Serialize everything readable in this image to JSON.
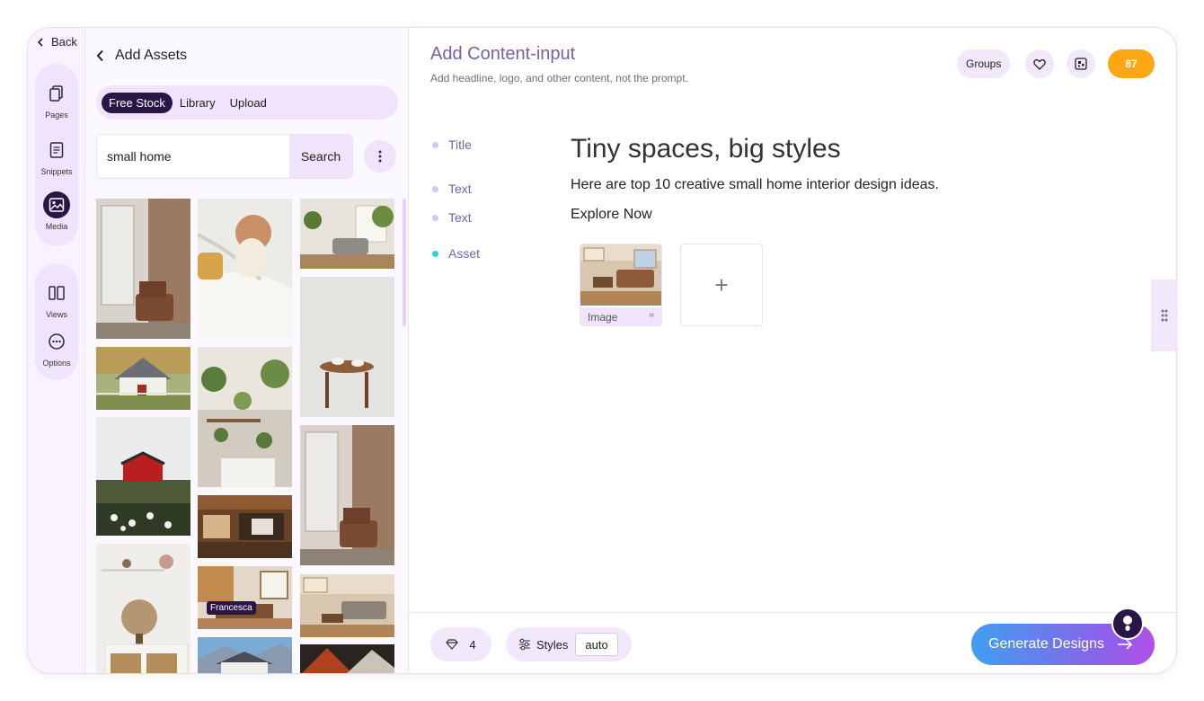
{
  "rail": {
    "back_label": "Back",
    "items": [
      {
        "id": "pages",
        "label": "Pages",
        "icon": "copy-icon"
      },
      {
        "id": "snippets",
        "label": "Snippets",
        "icon": "document-icon"
      },
      {
        "id": "media",
        "label": "Media",
        "icon": "image-icon",
        "active": true
      },
      {
        "id": "views",
        "label": "Views",
        "icon": "columns-icon"
      },
      {
        "id": "options",
        "label": "Options",
        "icon": "more-circle-icon"
      }
    ]
  },
  "assets": {
    "title": "Add Assets",
    "tabs": [
      "Free Stock",
      "Library",
      "Upload"
    ],
    "active_tab": "Free Stock",
    "search": {
      "value": "small home",
      "button": "Search"
    },
    "tooltip": "Francesca"
  },
  "main": {
    "title": "Add Content-input",
    "subtitle": "Add headline, logo, and other content, not the prompt.",
    "header": {
      "groups_label": "Groups",
      "credits": "87",
      "credits_color": "#fba612"
    },
    "fields": [
      {
        "label": "Title",
        "value": "Tiny spaces, big styles"
      },
      {
        "label": "Text",
        "value": "Here are top 10 creative small home interior design ideas."
      },
      {
        "label": "Text",
        "value": "Explore Now"
      },
      {
        "label": "Asset",
        "asset_label": "Image"
      }
    ],
    "footer": {
      "count": "4",
      "styles_label": "Styles",
      "styles_value": "auto",
      "generate_label": "Generate Designs"
    }
  }
}
